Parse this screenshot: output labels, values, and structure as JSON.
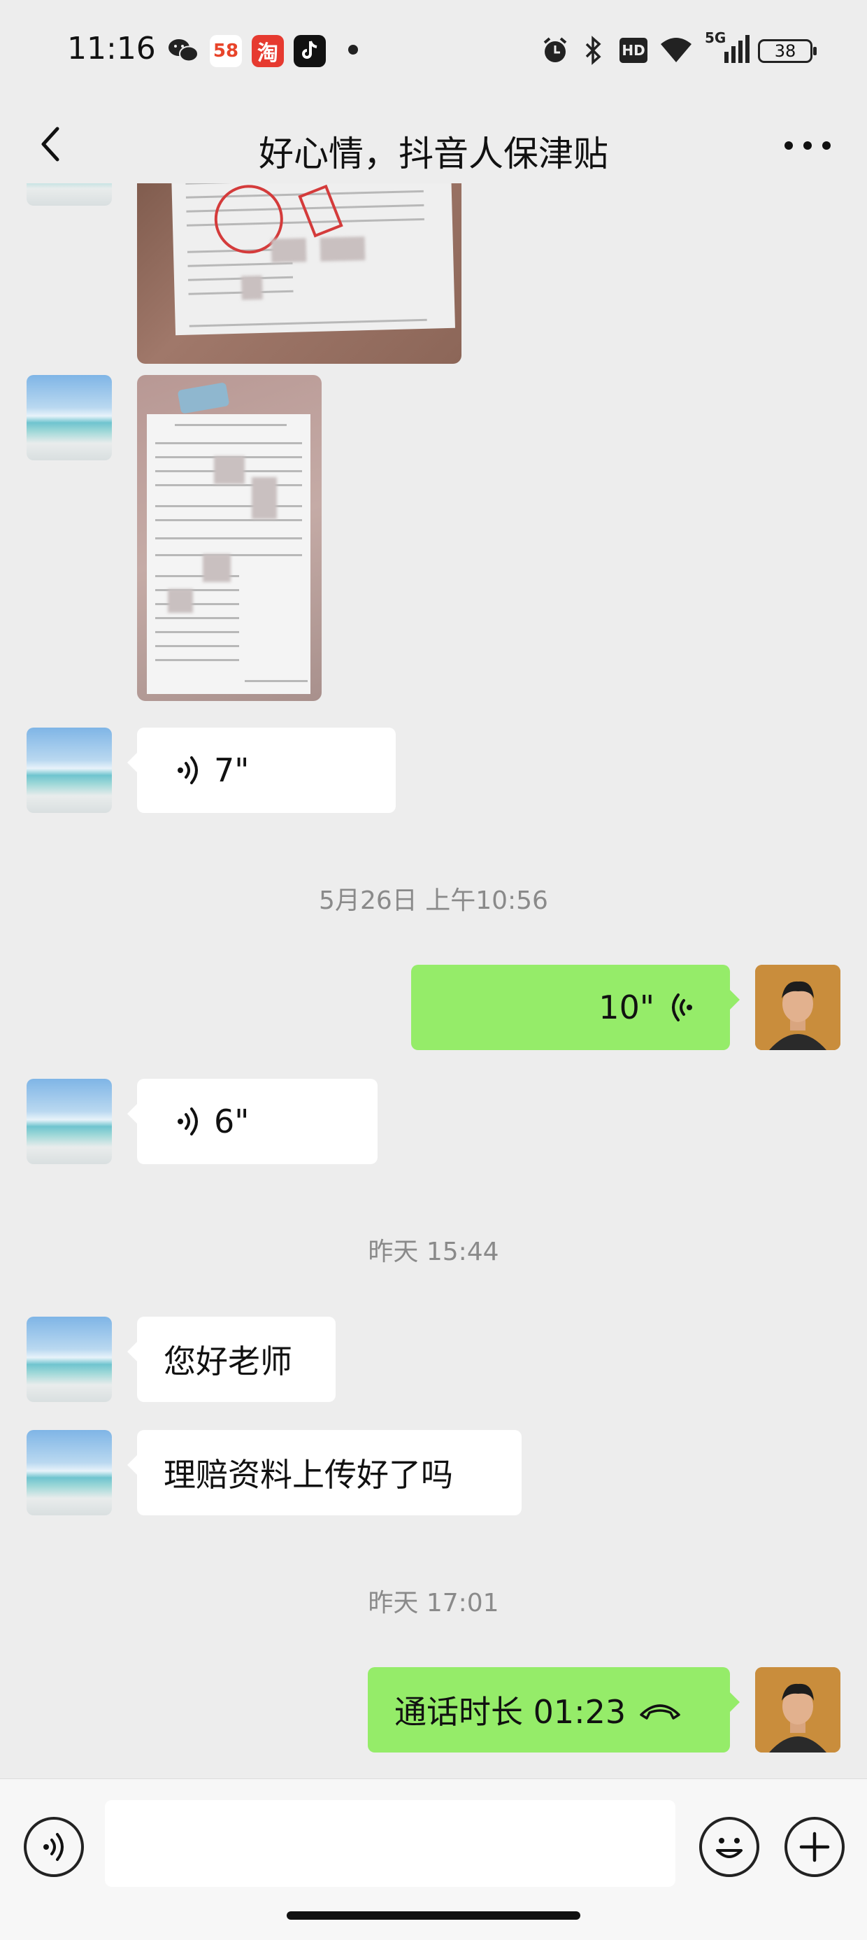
{
  "status_bar": {
    "time": "11:16",
    "app_icons": [
      "wechat-icon",
      "58-icon",
      "taobao-icon",
      "douyin-icon"
    ],
    "app_58_label": "58",
    "app_taobao_label": "淘",
    "network_label": "5G",
    "hd_label": "HD",
    "battery_level": "38"
  },
  "nav": {
    "title": "好心情，抖音人保津贴"
  },
  "messages": {
    "voice_1": {
      "duration": "7\""
    },
    "timestamp_1": "5月26日 上午10:56",
    "voice_out": {
      "duration": "10\""
    },
    "voice_2": {
      "duration": "6\""
    },
    "timestamp_2": "昨天 15:44",
    "text_1": "您好老师",
    "text_2": "理赔资料上传好了吗",
    "timestamp_3": "昨天 17:01",
    "call": {
      "label": "通话时长 01:23"
    }
  },
  "input": {
    "placeholder": ""
  },
  "colors": {
    "outgoing_bubble": "#95ec69",
    "incoming_bubble": "#ffffff",
    "background": "#ededed"
  }
}
